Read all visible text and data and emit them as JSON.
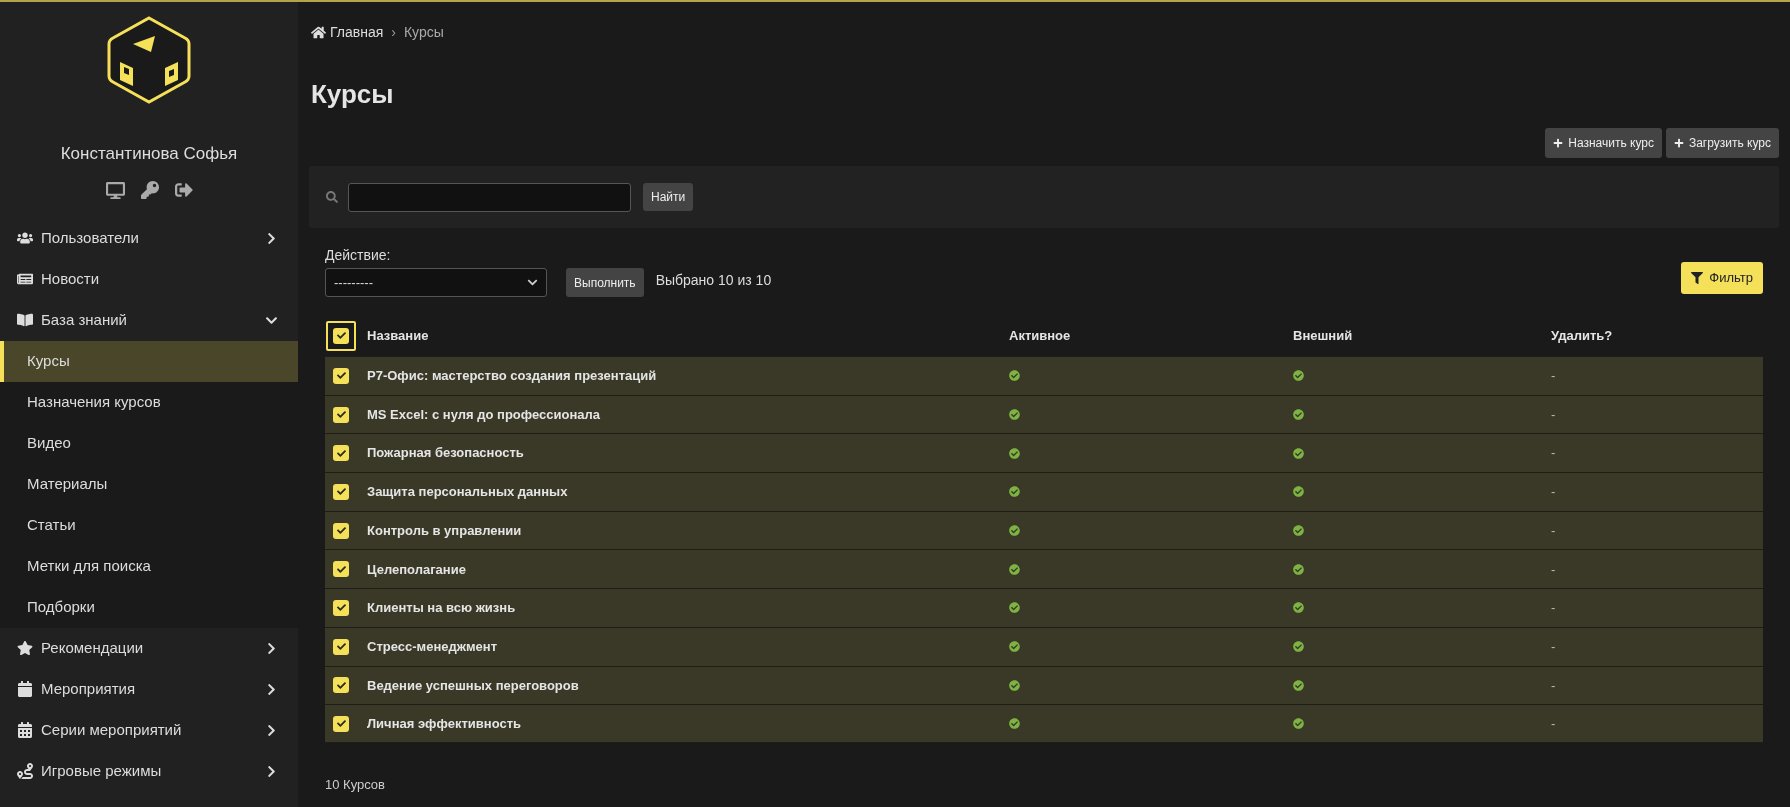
{
  "sidebar": {
    "user_name": "Константинова Софья",
    "menu": [
      {
        "label": "Пользователи",
        "kind": "group",
        "expanded": false
      },
      {
        "label": "Новости",
        "kind": "link"
      },
      {
        "label": "База знаний",
        "kind": "group",
        "expanded": true,
        "children": [
          {
            "label": "Курсы",
            "selected": true
          },
          {
            "label": "Назначения курсов",
            "selected": false
          },
          {
            "label": "Видео",
            "selected": false
          },
          {
            "label": "Материалы",
            "selected": false
          },
          {
            "label": "Статьи",
            "selected": false
          },
          {
            "label": "Метки для поиска",
            "selected": false
          },
          {
            "label": "Подборки",
            "selected": false
          }
        ]
      },
      {
        "label": "Рекомендации",
        "kind": "group",
        "expanded": false
      },
      {
        "label": "Мероприятия",
        "kind": "group",
        "expanded": false
      },
      {
        "label": "Серии мероприятий",
        "kind": "group",
        "expanded": false
      },
      {
        "label": "Игровые режимы",
        "kind": "group",
        "expanded": false
      }
    ]
  },
  "breadcrumb": [
    "Главная",
    "›",
    "Курсы"
  ],
  "title": "Курсы",
  "toolbar_buttons": [
    "Назначить курс",
    "Загрузить курс"
  ],
  "search": {
    "button": "Найти"
  },
  "actions": {
    "label": "Действие:",
    "select_value": "---------",
    "run_button": "Выполнить",
    "selection_count": "Выбрано 10 из 10",
    "filter_button": "Фильтр"
  },
  "table": {
    "select_all": true,
    "columns": [
      "Название",
      "Активное",
      "Внешний",
      "Удалить?"
    ],
    "rows": [
      {
        "checked": true,
        "name": "Р7-Офис: мастерство создания презентаций",
        "active": true,
        "external": true,
        "delete": "-"
      },
      {
        "checked": true,
        "name": "MS Excel: с нуля до профессионала",
        "active": true,
        "external": true,
        "delete": "-"
      },
      {
        "checked": true,
        "name": "Пожарная безопасность",
        "active": true,
        "external": true,
        "delete": "-"
      },
      {
        "checked": true,
        "name": "Защита персональных данных",
        "active": true,
        "external": true,
        "delete": "-"
      },
      {
        "checked": true,
        "name": "Контроль в управлении",
        "active": true,
        "external": true,
        "delete": "-"
      },
      {
        "checked": true,
        "name": "Целеполагание",
        "active": true,
        "external": true,
        "delete": "-"
      },
      {
        "checked": true,
        "name": "Клиенты на всю жизнь",
        "active": true,
        "external": true,
        "delete": "-"
      },
      {
        "checked": true,
        "name": "Стресс-менеджмент",
        "active": true,
        "external": true,
        "delete": "-"
      },
      {
        "checked": true,
        "name": "Ведение успешных переговоров",
        "active": true,
        "external": true,
        "delete": "-"
      },
      {
        "checked": true,
        "name": "Личная эффективность",
        "active": true,
        "external": true,
        "delete": "-"
      }
    ]
  },
  "footer_count": "10 Курсов"
}
